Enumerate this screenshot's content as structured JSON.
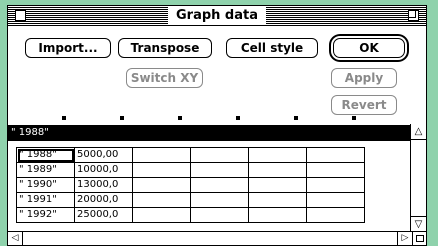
{
  "window": {
    "title": "Graph data"
  },
  "buttons": {
    "import": "Import...",
    "transpose": "Transpose",
    "cell_style": "Cell style",
    "ok": "OK",
    "switch_xy": "Switch XY",
    "apply": "Apply",
    "revert": "Revert"
  },
  "edit_line": {
    "value": "\" 1988\""
  },
  "table": {
    "rows": [
      {
        "label": "\" 1988\"",
        "value": "5000,00"
      },
      {
        "label": "\" 1989\"",
        "value": "10000,0"
      },
      {
        "label": "\" 1990\"",
        "value": "13000,0"
      },
      {
        "label": "\" 1991\"",
        "value": "20000,0"
      },
      {
        "label": "\" 1992\"",
        "value": "25000,0"
      }
    ]
  },
  "icons": {
    "close": "close-box-icon",
    "zoom": "zoom-box-icon",
    "scroll_up": "arrow-up-icon",
    "scroll_left": "arrow-left-icon",
    "scroll_right": "arrow-right-icon",
    "grow": "size-box-icon"
  }
}
